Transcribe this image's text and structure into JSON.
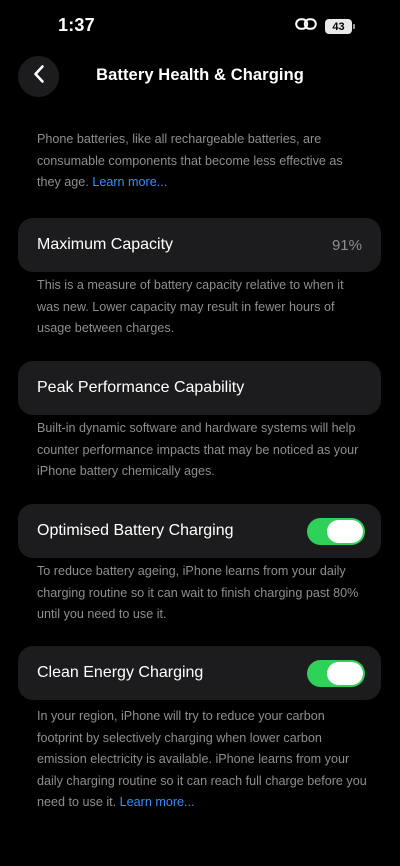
{
  "status_bar": {
    "time": "1:37",
    "battery_level": "43"
  },
  "header": {
    "title": "Battery Health & Charging"
  },
  "intro": {
    "text": "Phone batteries, like all rechargeable batteries, are consumable components that become less effective as they age. ",
    "link": "Learn more..."
  },
  "maximum_capacity": {
    "label": "Maximum Capacity",
    "value": "91%",
    "description": "This is a measure of battery capacity relative to when it was new. Lower capacity may result in fewer hours of usage between charges."
  },
  "peak_performance": {
    "label": "Peak Performance Capability",
    "description": "Built-in dynamic software and hardware systems will help counter performance impacts that may be noticed as your iPhone battery chemically ages."
  },
  "optimised_charging": {
    "label": "Optimised Battery Charging",
    "enabled": true,
    "description": "To reduce battery ageing, iPhone learns from your daily charging routine so it can wait to finish charging past 80% until you need to use it."
  },
  "clean_energy": {
    "label": "Clean Energy Charging",
    "enabled": true,
    "description": "In your region, iPhone will try to reduce your carbon footprint by selectively charging when lower carbon emission electricity is available. iPhone learns from your daily charging routine so it can reach full charge before you need to use it. ",
    "link": "Learn more..."
  },
  "colors": {
    "background": "#000000",
    "card": "#1c1c1e",
    "secondary_text": "#8e8e93",
    "link": "#3a8ef6",
    "toggle_on": "#30d158"
  }
}
